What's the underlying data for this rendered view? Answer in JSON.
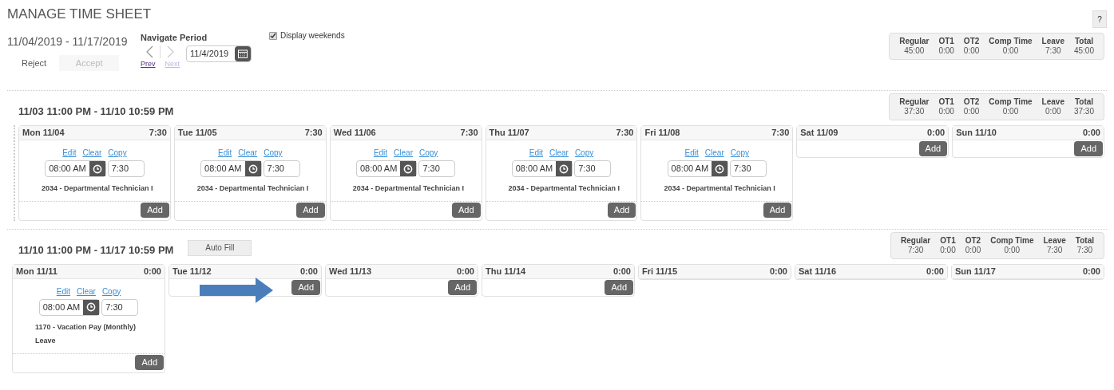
{
  "title": "MANAGE TIME SHEET",
  "help": "?",
  "period": {
    "range": "11/04/2019 - 11/17/2019",
    "actions": [
      {
        "label": "Reject",
        "disabled": false
      },
      {
        "label": "Accept",
        "disabled": true
      }
    ],
    "navigate": {
      "label": "Navigate Period",
      "prev": {
        "label": "Prev",
        "disabled": false
      },
      "next": {
        "label": "Next",
        "disabled": true
      },
      "date": "11/4/2019"
    },
    "display_weekends": {
      "label": "Display weekends",
      "checked": true
    }
  },
  "summary": [
    {
      "label": "Regular",
      "value": "45:00"
    },
    {
      "label": "OT1",
      "value": "0:00"
    },
    {
      "label": "OT2",
      "value": "0:00"
    },
    {
      "label": "Comp Time",
      "value": "0:00"
    },
    {
      "label": "Leave",
      "value": "7:30"
    },
    {
      "label": "Total",
      "value": "45:00"
    }
  ],
  "weeks": [
    {
      "range": "11/03 11:00 PM - 11/10 10:59 PM",
      "summary": [
        {
          "label": "Regular",
          "value": "37:30"
        },
        {
          "label": "OT1",
          "value": "0:00"
        },
        {
          "label": "OT2",
          "value": "0:00"
        },
        {
          "label": "Comp Time",
          "value": "0:00"
        },
        {
          "label": "Leave",
          "value": "0:00"
        },
        {
          "label": "Total",
          "value": "37:30"
        }
      ],
      "days": [
        {
          "label": "Mon 11/04",
          "total": "7:30",
          "kind": "entry",
          "links": [
            "Edit",
            "Clear",
            "Copy"
          ],
          "start": "08:00 AM",
          "hours": "7:30",
          "lines": [
            "2034 - Departmental Technician I"
          ],
          "add": "Add",
          "arrow": false
        },
        {
          "label": "Tue 11/05",
          "total": "7:30",
          "kind": "entry",
          "links": [
            "Edit",
            "Clear",
            "Copy"
          ],
          "start": "08:00 AM",
          "hours": "7:30",
          "lines": [
            "2034 - Departmental Technician I"
          ],
          "add": "Add",
          "arrow": false
        },
        {
          "label": "Wed 11/06",
          "total": "7:30",
          "kind": "entry",
          "links": [
            "Edit",
            "Clear",
            "Copy"
          ],
          "start": "08:00 AM",
          "hours": "7:30",
          "lines": [
            "2034 - Departmental Technician I"
          ],
          "add": "Add",
          "arrow": false
        },
        {
          "label": "Thu 11/07",
          "total": "7:30",
          "kind": "entry",
          "links": [
            "Edit",
            "Clear",
            "Copy"
          ],
          "start": "08:00 AM",
          "hours": "7:30",
          "lines": [
            "2034 - Departmental Technician I"
          ],
          "add": "Add",
          "arrow": false
        },
        {
          "label": "Fri 11/08",
          "total": "7:30",
          "kind": "entry",
          "links": [
            "Edit",
            "Clear",
            "Copy"
          ],
          "start": "08:00 AM",
          "hours": "7:30",
          "lines": [
            "2034 - Departmental Technician I"
          ],
          "add": "Add",
          "arrow": false
        },
        {
          "label": "Sat 11/09",
          "total": "0:00",
          "kind": "add",
          "add": "Add",
          "arrow": false
        },
        {
          "label": "Sun 11/10",
          "total": "0:00",
          "kind": "add",
          "add": "Add",
          "arrow": false
        }
      ]
    },
    {
      "range": "11/10 11:00 PM - 11/17 10:59 PM",
      "auto_fill": "Auto Fill",
      "summary": [
        {
          "label": "Regular",
          "value": "7:30"
        },
        {
          "label": "OT1",
          "value": "0:00"
        },
        {
          "label": "OT2",
          "value": "0:00"
        },
        {
          "label": "Comp Time",
          "value": "0:00"
        },
        {
          "label": "Leave",
          "value": "7:30"
        },
        {
          "label": "Total",
          "value": "7:30"
        }
      ],
      "days": [
        {
          "label": "Mon 11/11",
          "total": "0:00",
          "kind": "entry",
          "links": [
            "Edit",
            "Clear",
            "Copy"
          ],
          "start": "08:00 AM",
          "hours": "7:30",
          "lines": [
            "1170 - Vacation Pay (Monthly)",
            "Leave"
          ],
          "add": "Add",
          "arrow": false
        },
        {
          "label": "Tue 11/12",
          "total": "0:00",
          "kind": "add",
          "add": "Add",
          "arrow": true
        },
        {
          "label": "Wed 11/13",
          "total": "0:00",
          "kind": "add",
          "add": "Add",
          "arrow": false
        },
        {
          "label": "Thu 11/14",
          "total": "0:00",
          "kind": "add",
          "add": "Add",
          "arrow": false
        },
        {
          "label": "Fri 11/15",
          "total": "0:00",
          "kind": "closed",
          "arrow": false
        },
        {
          "label": "Sat 11/16",
          "total": "0:00",
          "kind": "closed",
          "arrow": false
        },
        {
          "label": "Sun 11/17",
          "total": "0:00",
          "kind": "closed",
          "arrow": false
        }
      ]
    }
  ]
}
